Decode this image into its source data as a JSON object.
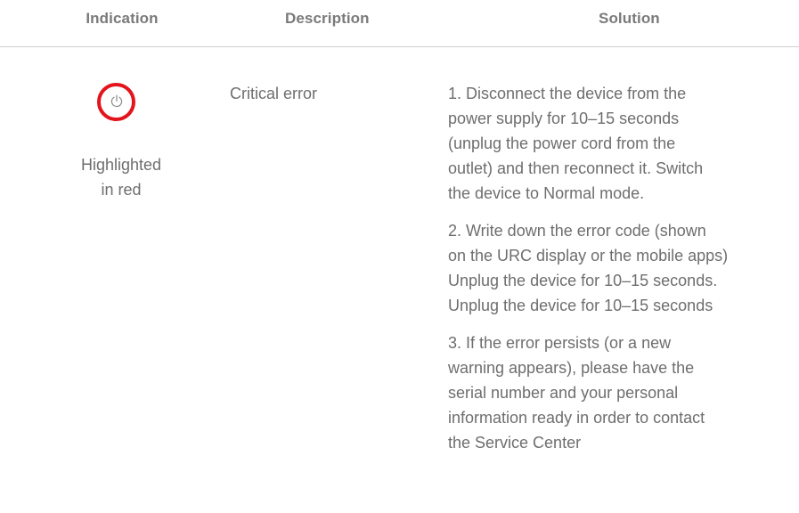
{
  "headers": {
    "indication": "Indication",
    "description": "Description",
    "solution": "Solution"
  },
  "row": {
    "indication_icon": "power-icon",
    "indication_color": "#e3141c",
    "indication_line1": "Highlighted",
    "indication_line2": "in red",
    "description": "Critical error",
    "solution": [
      {
        "lines": [
          "1. Disconnect the device from the",
          "power supply for 10–15 seconds",
          "(unplug the power cord from the",
          "outlet) and then reconnect it. Switch",
          "the device to Normal mode."
        ]
      },
      {
        "lines": [
          "2. Write down the error code (shown",
          "on the URC display or the mobile apps)",
          "Unplug the device for 10–15 seconds.",
          "Unplug the device for 10–15 seconds"
        ]
      },
      {
        "lines": [
          "3. If the error persists (or a new",
          "warning appears), please have the",
          "serial number and your personal",
          "information ready in order to contact",
          "the Service Center"
        ]
      }
    ]
  }
}
